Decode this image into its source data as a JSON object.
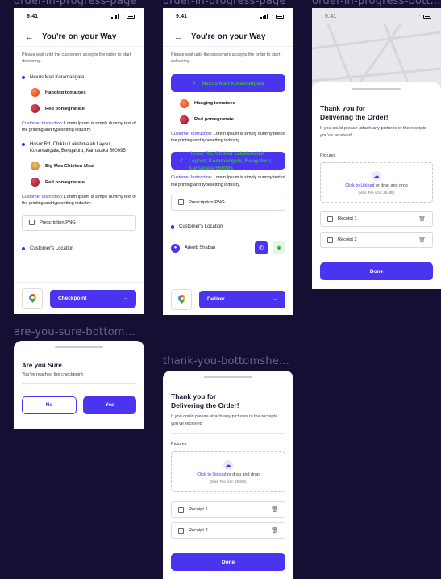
{
  "frame_labels": {
    "f1": "order-in-progress-page",
    "f2": "order-in-progress-page",
    "f3": "order-in-progress-bott...",
    "f4": "are-you-sure-bottom...",
    "f5": "thank-you-bottomshe..."
  },
  "status": {
    "time": "9:41"
  },
  "screen1": {
    "title": "You're on your Way",
    "hint": "Please wait until the customers accepts the order to start delivering.",
    "stop1": "Nexus Mall Koramangala",
    "items1": [
      "Hanging tomatoes",
      "Red pomegranate"
    ],
    "instr_label": "Customer Instruction:",
    "instr_text": " Lorem Ipsum is simply dummy text of the printing and typesetting industry.",
    "stop2": "Hosur Rd, Chikku Lakshmaiah Layout, Koramangala, Bengaluru, Karnataka 560095",
    "items2": [
      "Big Mac Chicken Meal",
      "Red pomegranate"
    ],
    "file": "Prescription.PNG",
    "customer_location": "Customer's Location",
    "cta": "Checkpoint"
  },
  "screen2": {
    "title": "You're on your Way",
    "hint": "Please wait until the customers accepts the order to start delivering.",
    "stop1": "Nexus Mall Koramangala",
    "items1": [
      "Hanging tomatoes",
      "Red pomegranate"
    ],
    "instr_label": "Customer Instruction:",
    "instr_text": " Lorem Ipsum is simply dummy text of the printing and typesetting industry.",
    "stop2": "Hosur Rd, Chikku Lakshmaiah Layout, Koramangala, Bengaluru, Karnataka 560095",
    "file": "Prescription.PNG",
    "customer_location": "Customer's Location",
    "customer_name": "Adeeb Shaban",
    "cta": "Deliver"
  },
  "sheet_thanks": {
    "title_line1": "Thank you for",
    "title_line2": "Delivering the Order!",
    "subtitle": "If you could please attach any pictures of the receipts you've received",
    "pictures_label": "Pictures",
    "upload_link": "Click to Upload",
    "upload_rest": " or drag and drop",
    "upload_size": "(Max. File size: 25 MB)",
    "receipts": [
      "Receipt 1",
      "Receipt 2"
    ],
    "done": "Done"
  },
  "sheet_sure": {
    "title": "Are you Sure",
    "subtitle": "You've reached the checkpoint",
    "no": "No",
    "yes": "Yes"
  }
}
